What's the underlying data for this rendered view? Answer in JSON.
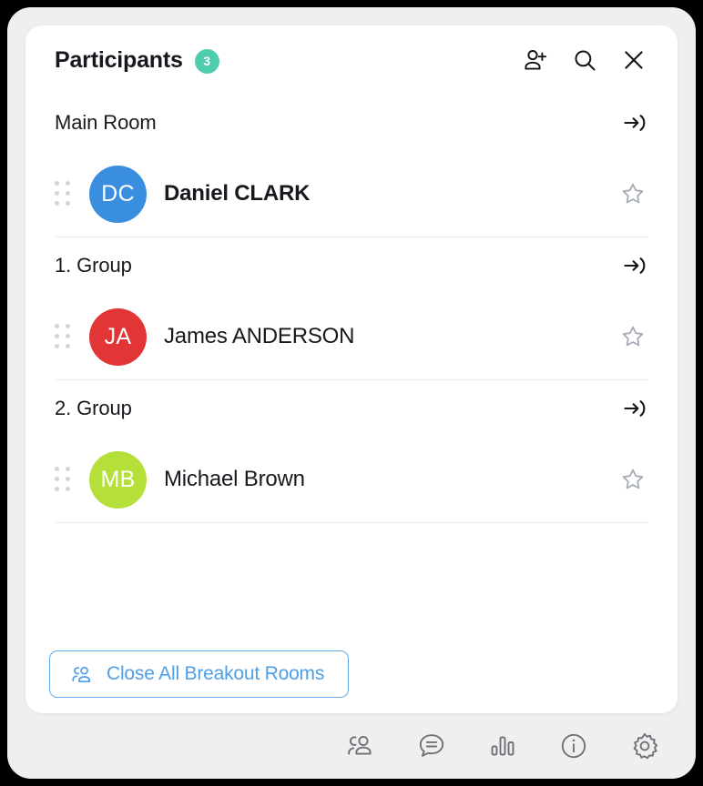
{
  "header": {
    "title": "Participants",
    "count": "3",
    "badge_color": "#4ecdac",
    "actions": [
      {
        "name": "add-participant-icon",
        "label": "Add participant"
      },
      {
        "name": "search-icon",
        "label": "Search"
      },
      {
        "name": "close-icon",
        "label": "Close"
      }
    ]
  },
  "rooms": [
    {
      "name": "Main Room",
      "enter_label": "Enter room",
      "participants": [
        {
          "name": "Daniel CLARK",
          "initials": "DC",
          "avatar_color": "#3a8ee0",
          "is_self": true,
          "favorite": false
        }
      ]
    },
    {
      "name": "1. Group",
      "enter_label": "Enter room",
      "participants": [
        {
          "name": "James ANDERSON",
          "initials": "JA",
          "avatar_color": "#e23535",
          "is_self": false,
          "favorite": false
        }
      ]
    },
    {
      "name": "2. Group",
      "enter_label": "Enter room",
      "participants": [
        {
          "name": "Michael Brown",
          "initials": "MB",
          "avatar_color": "#b5e03a",
          "is_self": false,
          "favorite": false
        }
      ]
    }
  ],
  "footer": {
    "close_all_label": "Close All Breakout Rooms",
    "accent_color": "#4d9fe8",
    "icon": "group-people-icon"
  },
  "toolbar": {
    "items": [
      {
        "name": "participants-icon",
        "label": "Participants"
      },
      {
        "name": "chat-icon",
        "label": "Chat"
      },
      {
        "name": "polls-icon",
        "label": "Polls"
      },
      {
        "name": "info-icon",
        "label": "Info"
      },
      {
        "name": "settings-gear-icon",
        "label": "Settings"
      }
    ]
  }
}
